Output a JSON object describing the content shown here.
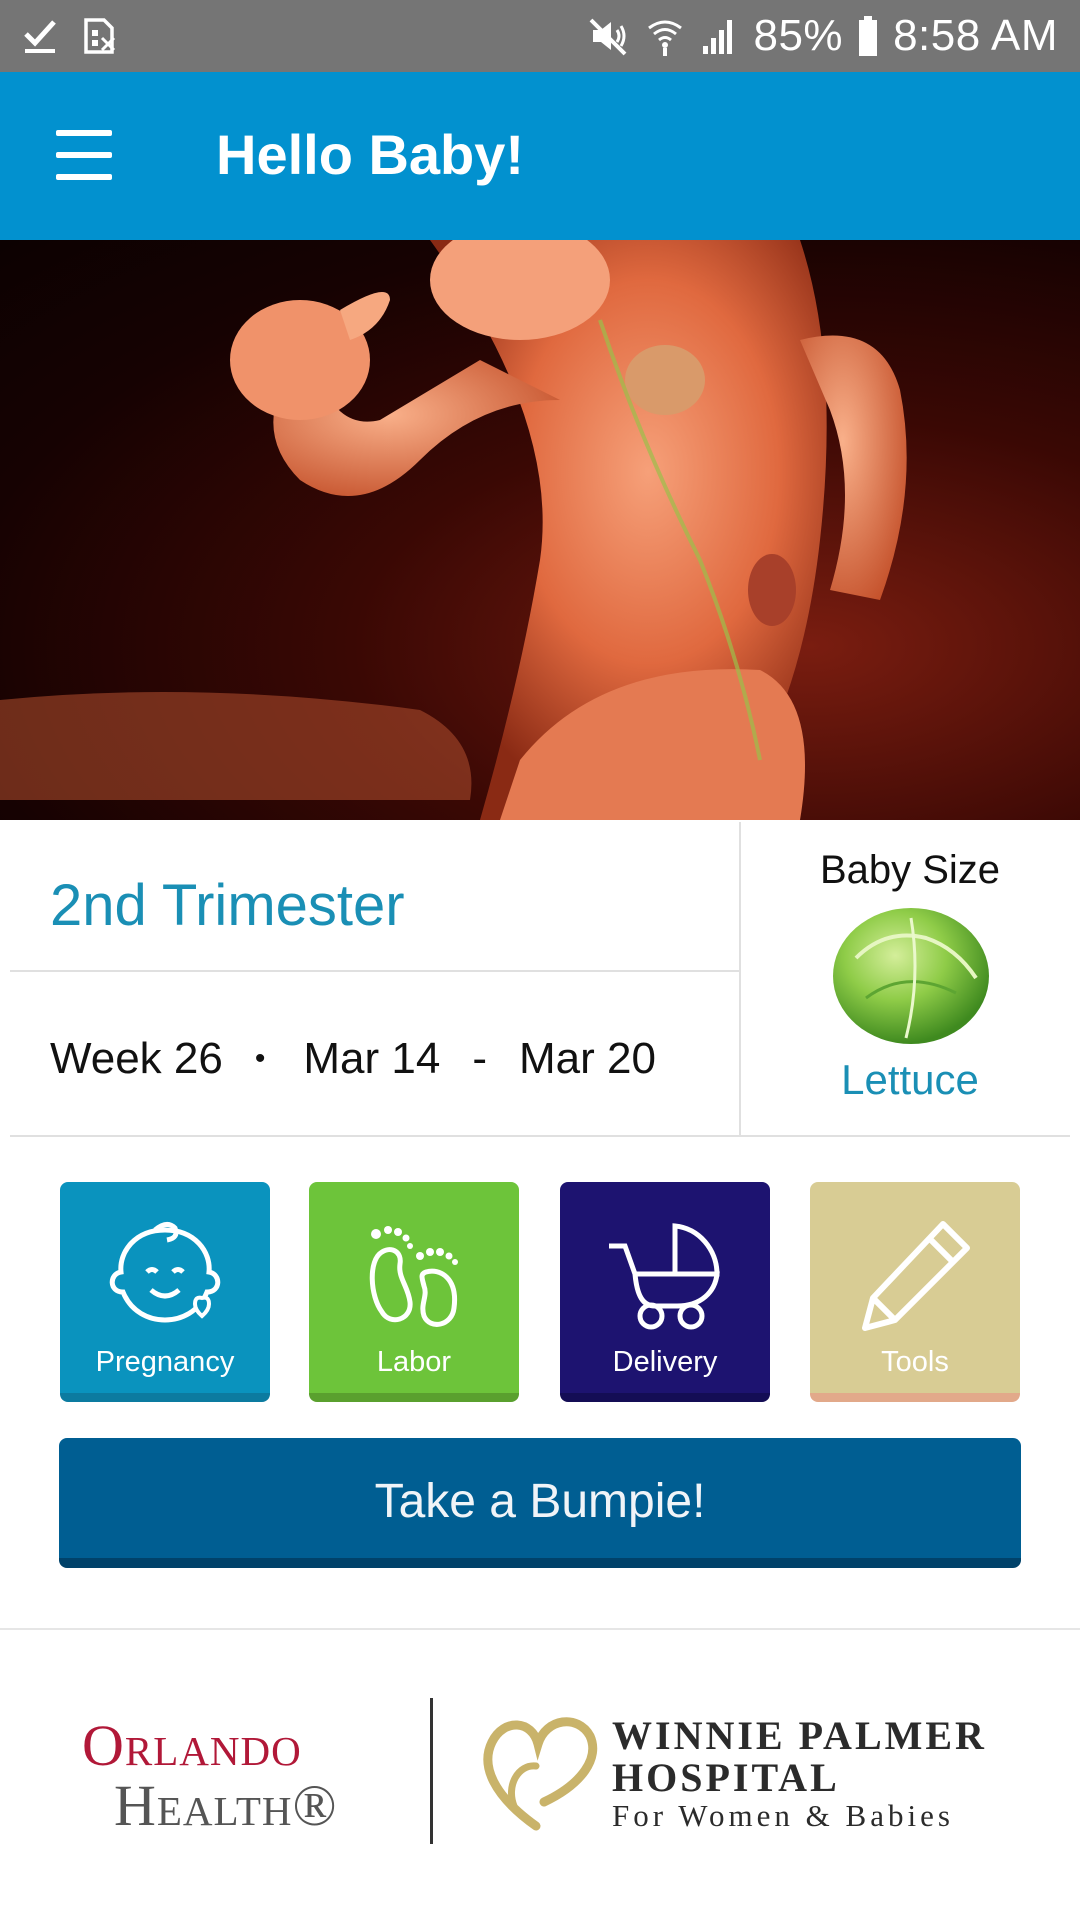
{
  "status_bar": {
    "battery_percent": "85%",
    "time": "8:58 AM",
    "icons": [
      "check-icon",
      "sim-icon",
      "mute-icon",
      "wifi-icon",
      "signal-icon",
      "battery-icon"
    ]
  },
  "app_bar": {
    "title": "Hello Baby!",
    "menu_icon": "hamburger-menu-icon"
  },
  "hero": {
    "image": "fetus-week-26-illustration"
  },
  "pregnancy_info": {
    "trimester": "2nd Trimester",
    "week": "Week 26",
    "separator": "•",
    "start_date": "Mar 14",
    "range_dash": "-",
    "end_date": "Mar 20"
  },
  "baby_size": {
    "label": "Baby Size",
    "image": "lettuce-image",
    "name": "Lettuce"
  },
  "tiles": [
    {
      "label": "Pregnancy",
      "icon": "baby-face-icon",
      "color": "#0a93be"
    },
    {
      "label": "Labor",
      "icon": "footprints-icon",
      "color": "#6dc43a"
    },
    {
      "label": "Delivery",
      "icon": "stroller-icon",
      "color": "#1d1370"
    },
    {
      "label": "Tools",
      "icon": "pencil-icon",
      "color": "#d8cc94"
    }
  ],
  "bumpie_button": {
    "label": "Take a Bumpie!",
    "color": "#005e92"
  },
  "footer": {
    "orlando_line1": "Orlando",
    "orlando_line2": "Health®",
    "winnie_line1": "WINNIE PALMER",
    "winnie_line2": "HOSPITAL",
    "winnie_line3": "For Women & Babies"
  },
  "colors": {
    "app_bar": "#0291cf",
    "accent_text": "#1a8fb5",
    "status_bar": "#757575"
  }
}
